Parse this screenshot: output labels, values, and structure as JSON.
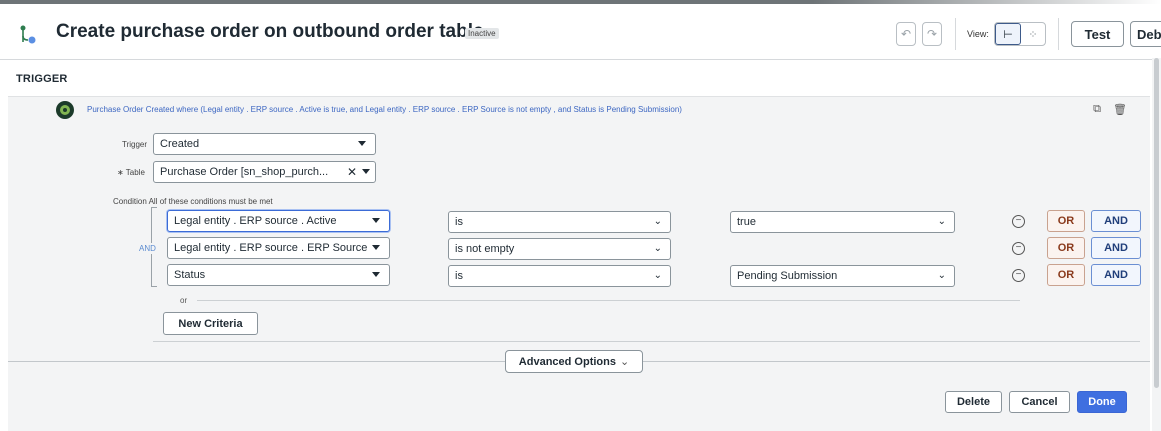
{
  "header": {
    "title": "Create purchase order on outbound order table",
    "status": "Inactive",
    "view_label": "View:",
    "test_label": "Test",
    "debug_label": "Debu"
  },
  "section_heading": "TRIGGER",
  "trigger": {
    "summary": "Purchase Order Created where (Legal entity . ERP source . Active is true, and Legal entity . ERP source . ERP Source is not empty , and Status is Pending Submission)",
    "trigger_label": "Trigger",
    "trigger_value": "Created",
    "table_label": "∗ Table",
    "table_value": "Purchase Order [sn_shop_purch...",
    "condition_label": "Condition",
    "condition_hint": "All of these conditions must be met",
    "and_label": "AND",
    "conditions": [
      {
        "field": "Legal entity . ERP source . Active",
        "operator": "is",
        "value": "true"
      },
      {
        "field": "Legal entity . ERP source . ERP Source",
        "operator": "is not empty",
        "value": ""
      },
      {
        "field": "Status",
        "operator": "is",
        "value": "Pending Submission"
      }
    ],
    "or_button": "OR",
    "and_button": "AND",
    "or_separator": "or",
    "new_criteria": "New Criteria"
  },
  "advanced_options": "Advanced Options",
  "footer": {
    "delete": "Delete",
    "cancel": "Cancel",
    "done": "Done"
  }
}
